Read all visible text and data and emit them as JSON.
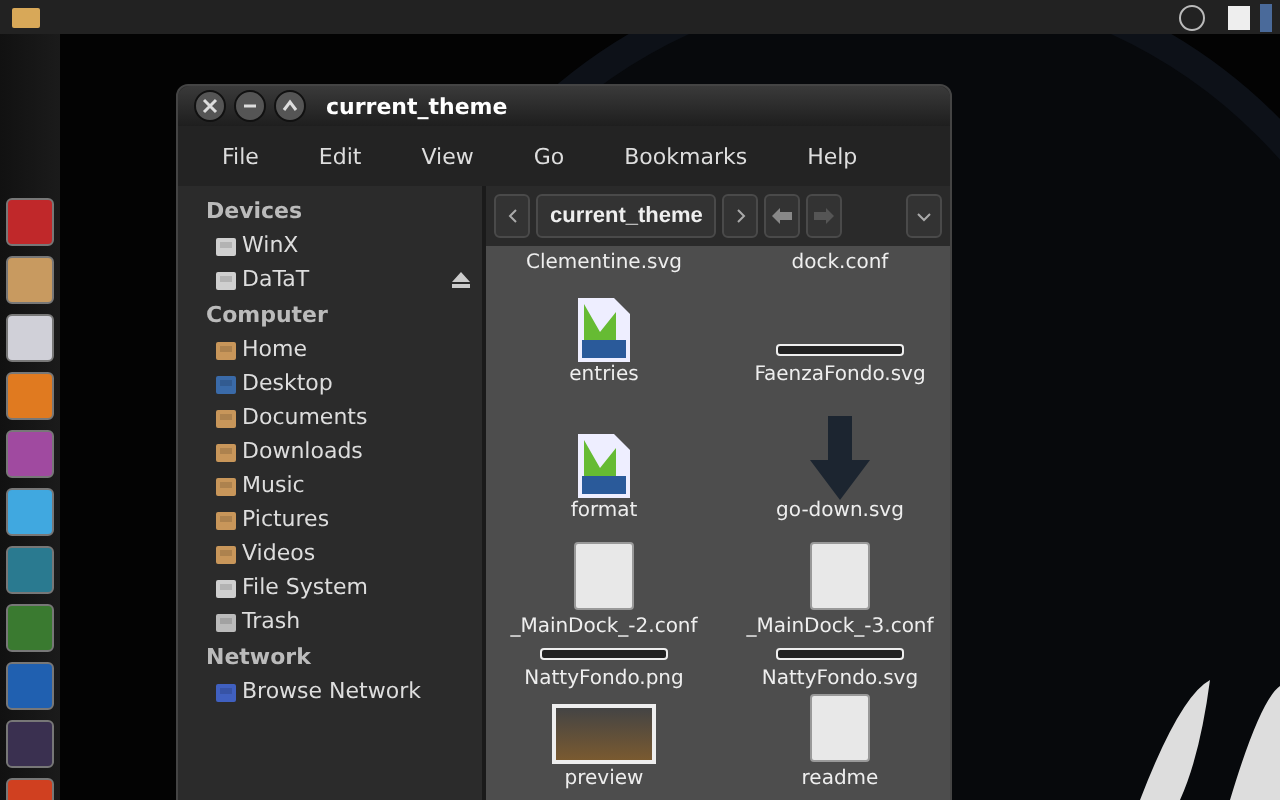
{
  "window": {
    "title": "current_theme"
  },
  "menu": [
    "File",
    "Edit",
    "View",
    "Go",
    "Bookmarks",
    "Help"
  ],
  "toolbar": {
    "path": "current_theme"
  },
  "launcher": [
    {
      "color": "#c0282a"
    },
    {
      "color": "#c89a60"
    },
    {
      "color": "#d0d0d8"
    },
    {
      "color": "#e07a20"
    },
    {
      "color": "#a04aa0"
    },
    {
      "color": "#40a8e0"
    },
    {
      "color": "#2a7a90"
    },
    {
      "color": "#3a7a30"
    },
    {
      "color": "#2060b0"
    },
    {
      "color": "#3a3050"
    },
    {
      "color": "#d04020"
    }
  ],
  "sidebar": [
    {
      "heading": "Devices",
      "items": [
        {
          "label": "WinX",
          "kind": "drive",
          "eject": false
        },
        {
          "label": "DaTaT",
          "kind": "drive",
          "eject": true
        }
      ]
    },
    {
      "heading": "Computer",
      "items": [
        {
          "label": "Home",
          "kind": "folder",
          "eject": false
        },
        {
          "label": "Desktop",
          "kind": "desktop",
          "eject": false
        },
        {
          "label": "Documents",
          "kind": "folder",
          "eject": false
        },
        {
          "label": "Downloads",
          "kind": "folder",
          "eject": false
        },
        {
          "label": "Music",
          "kind": "folder",
          "eject": false
        },
        {
          "label": "Pictures",
          "kind": "folder",
          "eject": false
        },
        {
          "label": "Videos",
          "kind": "folder",
          "eject": false
        },
        {
          "label": "File System",
          "kind": "drive",
          "eject": false
        },
        {
          "label": "Trash",
          "kind": "trash",
          "eject": false
        }
      ]
    },
    {
      "heading": "Network",
      "items": [
        {
          "label": "Browse Network",
          "kind": "network",
          "eject": false
        }
      ]
    }
  ],
  "files": [
    {
      "name": "Clementine.svg",
      "kind": "cut"
    },
    {
      "name": "dock.conf",
      "kind": "cut"
    },
    {
      "name": "entries",
      "kind": "dxf"
    },
    {
      "name": "FaenzaFondo.svg",
      "kind": "bar"
    },
    {
      "name": "format",
      "kind": "dxf"
    },
    {
      "name": "go-down.svg",
      "kind": "arrow"
    },
    {
      "name": "_MainDock_-2.conf",
      "kind": "text"
    },
    {
      "name": "_MainDock_-3.conf",
      "kind": "text"
    },
    {
      "name": "NattyFondo.png",
      "kind": "bar"
    },
    {
      "name": "NattyFondo.svg",
      "kind": "bar"
    },
    {
      "name": "preview",
      "kind": "photo"
    },
    {
      "name": "readme",
      "kind": "text"
    }
  ]
}
